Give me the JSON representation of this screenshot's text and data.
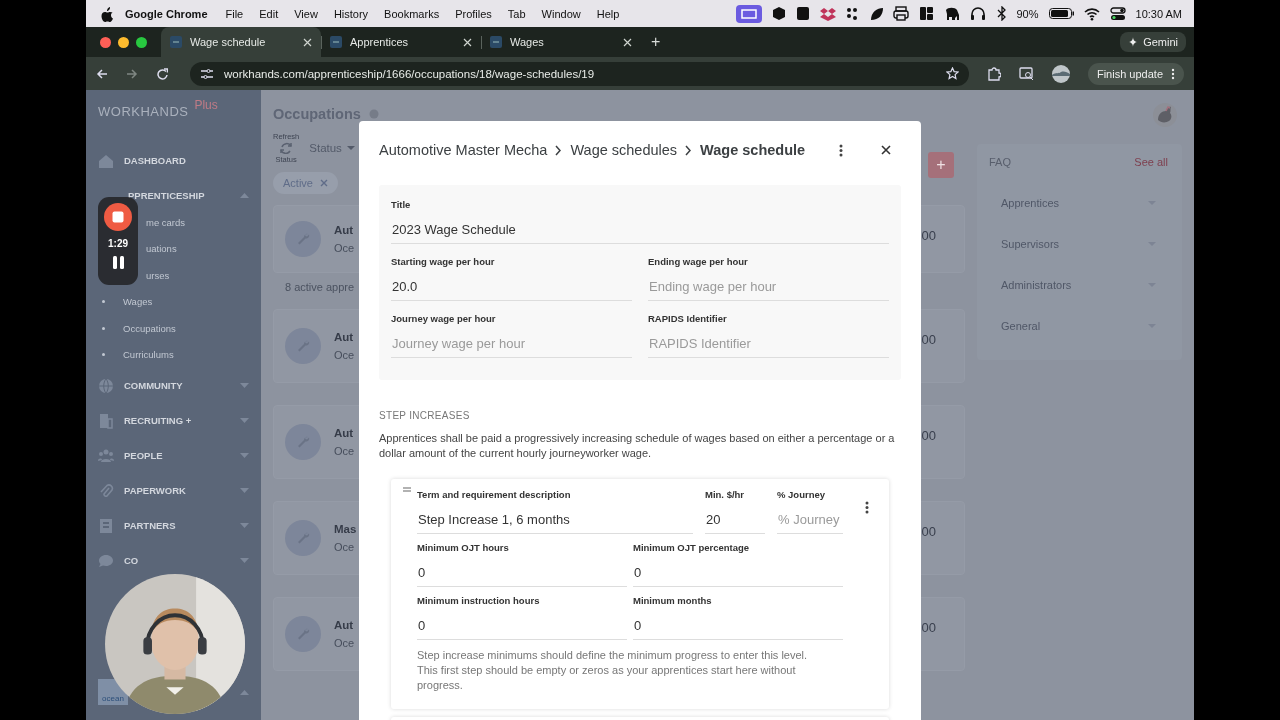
{
  "menu_bar": {
    "app": "Google Chrome",
    "menus": [
      "File",
      "Edit",
      "View",
      "History",
      "Bookmarks",
      "Profiles",
      "Tab",
      "Window",
      "Help"
    ],
    "battery": "90%",
    "time": "10:30 AM"
  },
  "browser": {
    "tabs": [
      {
        "label": "Wage schedule",
        "selected": true
      },
      {
        "label": "Apprentices",
        "selected": false
      },
      {
        "label": "Wages",
        "selected": false
      }
    ],
    "new_tab": "+",
    "gemini": "Gemini",
    "url": "workhands.com/apprenticeship/1666/occupations/18/wage-schedules/19",
    "update": "Finish update"
  },
  "sidebar": {
    "brand": "WORKHANDS",
    "brand_tag": "Plus",
    "items": [
      {
        "label": "DASHBOARD",
        "kind": "home"
      },
      {
        "label": "PPRENTICESHIP",
        "kind": "covered",
        "expanded": true,
        "children": [
          {
            "label": "me cards",
            "kind": "covered"
          },
          {
            "label": "uations",
            "kind": "covered"
          },
          {
            "label": "urses",
            "kind": "covered"
          },
          {
            "label": "Wages",
            "kind": "bullet"
          },
          {
            "label": "Occupations",
            "kind": "bullet"
          },
          {
            "label": "Curriculums",
            "kind": "bullet"
          }
        ]
      },
      {
        "label": "COMMUNITY",
        "kind": "globe",
        "expanded": false
      },
      {
        "label": "RECRUITING +",
        "kind": "building",
        "expanded": false
      },
      {
        "label": "PEOPLE",
        "kind": "people",
        "expanded": false
      },
      {
        "label": "PAPERWORK",
        "kind": "clip",
        "expanded": false
      },
      {
        "label": "PARTNERS",
        "kind": "office",
        "expanded": false
      },
      {
        "label": "CO",
        "kind": "chat",
        "expanded": false
      }
    ],
    "footer": {
      "logo": "ocean",
      "expanded": true
    }
  },
  "recorder": {
    "time": "1:29"
  },
  "main": {
    "title": "Occupations",
    "refresh_label": "Refresh",
    "status_label": "Status",
    "status_filter": "Status",
    "chip": "Active",
    "add_button": "+",
    "count": "8 active appre",
    "cards": [
      {
        "title": "Aut",
        "subtitle": "Oce",
        "value": "00"
      },
      {
        "title": "Aut",
        "subtitle": "Oce",
        "value": "00"
      },
      {
        "title": "Aut",
        "subtitle": "Oce",
        "value": "00"
      },
      {
        "title": "Mas",
        "subtitle": "Oce",
        "value": "00"
      },
      {
        "title": "Aut",
        "subtitle": "Oce",
        "value": "00"
      }
    ]
  },
  "faq": {
    "title": "FAQ",
    "see_all": "See all",
    "items": [
      "Apprentices",
      "Supervisors",
      "Administrators",
      "General"
    ]
  },
  "modal": {
    "breadcrumb": [
      "Automotive Master Mecha",
      "Wage schedules",
      "Wage schedule"
    ],
    "fields": [
      {
        "label": "Title",
        "value": "2023 Wage Schedule",
        "wide": true
      },
      {
        "label": "Starting wage per hour",
        "value": "20.0",
        "wide": false
      },
      {
        "label": "Ending wage per hour",
        "placeholder": "Ending wage per hour",
        "wide": false
      },
      {
        "label": "Journey wage per hour",
        "placeholder": "Journey wage per hour",
        "wide": false
      },
      {
        "label": "RAPIDS Identifier",
        "placeholder": "RAPIDS Identifier",
        "wide": false
      }
    ],
    "section": "STEP INCREASES",
    "intro": "Apprentices shall be paid a progressively increasing schedule of wages based on either a percentage or a dollar amount of the current hourly journeyworker wage.",
    "step": {
      "desc_label": "Term and requirement description",
      "min_label": "Min. $/hr",
      "journey_label": "% Journey",
      "desc": "Step Increase 1, 6 months",
      "min": "20",
      "journey_placeholder": "% Journey",
      "minimums": [
        {
          "label": "Minimum OJT hours",
          "value": "0"
        },
        {
          "label": "Minimum OJT percentage",
          "value": "0"
        },
        {
          "label": "Minimum instruction hours",
          "value": "0"
        },
        {
          "label": "Minimum months",
          "value": "0"
        }
      ],
      "note": "Step increase minimums should define the minimum progress to enter this level. This first step should be empty or zeros as your apprentices start here without progress."
    }
  }
}
